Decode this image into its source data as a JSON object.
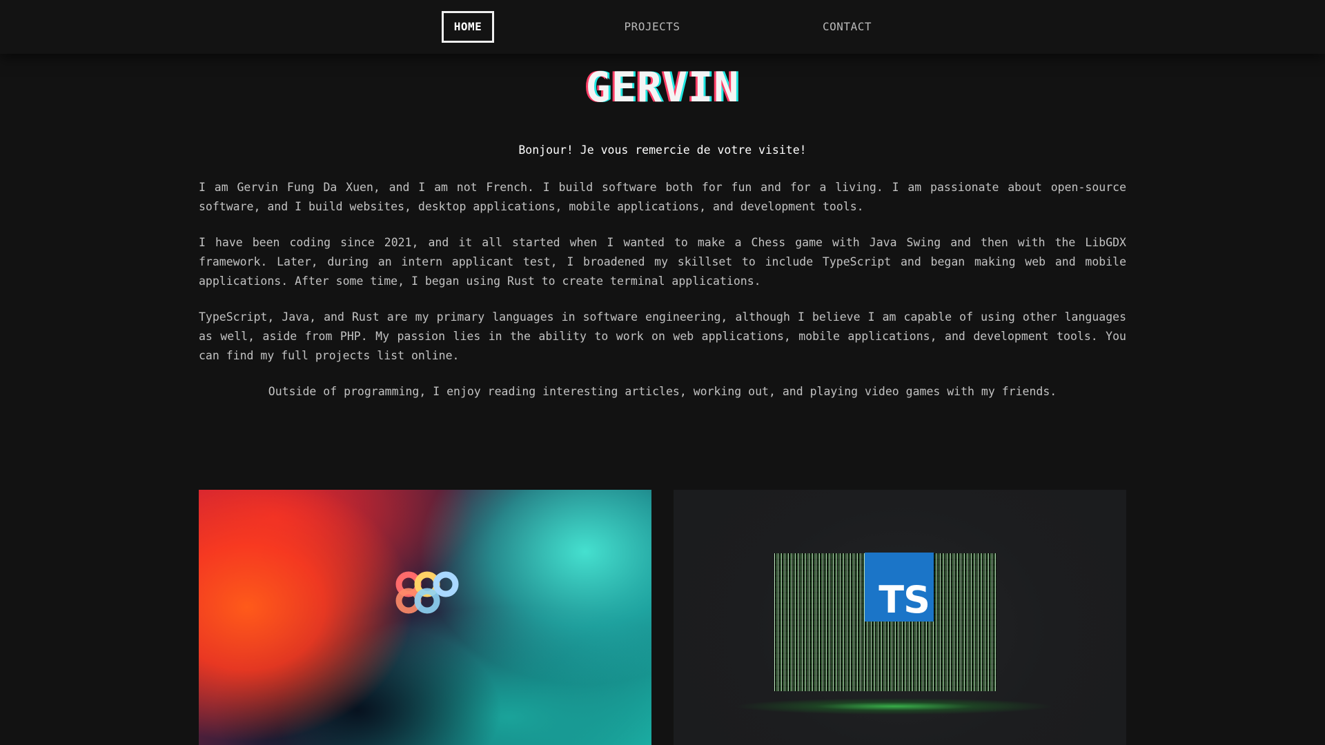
{
  "nav": {
    "home": "HOME",
    "projects": "PROJECTS",
    "contact": "CONTACT"
  },
  "header": {
    "title": "GERVIN"
  },
  "intro": {
    "greeting": "Bonjour! Je vous remercie de votre visite!",
    "paragraphs": [
      "I am Gervin Fung Da Xuen, and I am not French. I build software both for fun and for a living. I am passionate about open-source software, and I build websites, desktop applications, mobile applications, and development tools.",
      "I have been coding since 2021, and it all started when I wanted to make a Chess game with Java Swing and then with the LibGDX framework. Later, during an intern applicant test, I broadened my skillset to include TypeScript and began making web and mobile applications. After some time, I began using Rust to create terminal applications.",
      "TypeScript, Java, and Rust are my primary languages in software engineering, although I believe I am capable of using other languages as well, aside from PHP. My passion lies in the ability to work on web applications, mobile applications, and development tools. You can find my full projects list online.",
      "Outside of programming, I enjoy reading interesting articles, working out, and playing video games with my friends."
    ]
  },
  "cards": {
    "right_badge": "TS"
  },
  "icons": {
    "left_card": "colorful-knot-logo-icon",
    "right_card": "typescript-logo-icon"
  },
  "colors": {
    "background": "#121212",
    "title_glitch_red": "#ff3f67",
    "title_glitch_cyan": "#20e6e0",
    "ts_blue": "#1b75c8"
  }
}
